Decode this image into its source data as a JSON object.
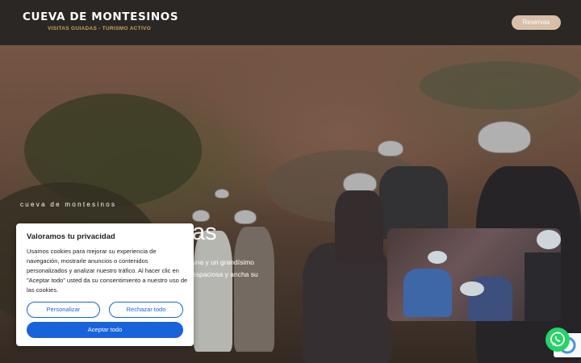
{
  "header": {
    "logo_title": "CUEVA DE MONTESINOS",
    "logo_subtitle": "VISITAS GUIADAS - TURISMO ACTIVO",
    "reservas_label": "Reservas"
  },
  "hero": {
    "kicker": "cueva de montesinos",
    "title_fragment": "as",
    "text_line1": "una y un grandísimo",
    "text_line2": "espaciosa y ancha su"
  },
  "cookie_banner": {
    "title": "Valoramos tu privacidad",
    "body": "Usamos cookies para mejorar su experiencia de navegación, mostrarle anuncios o contenidos personalizados y analizar nuestro tráfico. Al hacer clic en \"Aceptar todo\" usted da su consentimiento a nuestro uso de las cookies.",
    "customize_label": "Personalizar",
    "reject_label": "Rechazar todo",
    "accept_label": "Aceptar todo"
  },
  "colors": {
    "header_bg": "#2a2724",
    "accent_gold": "#c9a45c",
    "reservas_bg": "#d8bfa7",
    "cookie_blue": "#1863dc",
    "whatsapp_green": "#25d366"
  },
  "icons": {
    "whatsapp": "whatsapp-icon",
    "recaptcha": "recaptcha-icon"
  }
}
